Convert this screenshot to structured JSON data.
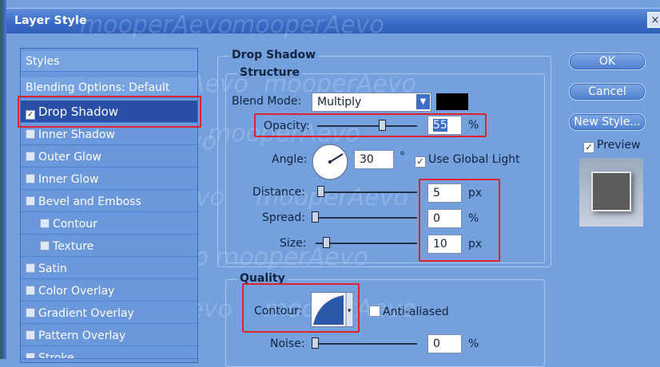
{
  "window": {
    "title": "Layer Style",
    "close_glyph": "×"
  },
  "styles_list": {
    "items": [
      {
        "label": "Styles"
      },
      {
        "label": "Blending Options: Default"
      },
      {
        "label": "Drop Shadow",
        "checked": true,
        "selected": true
      },
      {
        "label": "Inner Shadow",
        "checked": false
      },
      {
        "label": "Outer Glow",
        "checked": false
      },
      {
        "label": "Inner Glow",
        "checked": false
      },
      {
        "label": "Bevel and Emboss",
        "checked": false
      },
      {
        "label": "Contour",
        "checked": false
      },
      {
        "label": "Texture",
        "checked": false
      },
      {
        "label": "Satin",
        "checked": false
      },
      {
        "label": "Color Overlay",
        "checked": false
      },
      {
        "label": "Gradient Overlay",
        "checked": false
      },
      {
        "label": "Pattern Overlay",
        "checked": false
      },
      {
        "label": "Stroke",
        "checked": false
      }
    ]
  },
  "drop_shadow": {
    "title": "Drop Shadow",
    "structure": {
      "title": "Structure",
      "blend_mode_label": "Blend Mode:",
      "blend_mode_value": "Multiply",
      "shadow_color": "#000000",
      "opacity_label": "Opacity:",
      "opacity_value": "55",
      "opacity_unit": "%",
      "opacity_level": 0.55,
      "angle_label": "Angle:",
      "angle_value": "30",
      "angle_unit": "°",
      "use_global_light": "Use Global Light",
      "distance_label": "Distance:",
      "distance_value": "5",
      "distance_unit": "px",
      "spread_label": "Spread:",
      "spread_value": "0",
      "spread_unit": "%",
      "size_label": "Size:",
      "size_value": "10",
      "size_unit": "px"
    },
    "quality": {
      "title": "Quality",
      "contour_label": "Contour:",
      "anti_aliased": "Anti-aliased",
      "noise_label": "Noise:",
      "noise_value": "0",
      "noise_unit": "%"
    }
  },
  "buttons": {
    "ok": "OK",
    "cancel": "Cancel",
    "new_style": "New Style..."
  },
  "preview": {
    "label": "Preview",
    "checked": true
  },
  "watermark": "mooperAevo",
  "colors": {
    "dialog_bg": "#75a0de",
    "selected_item": "#2b4fa6",
    "highlight_box": "#e0202a"
  }
}
